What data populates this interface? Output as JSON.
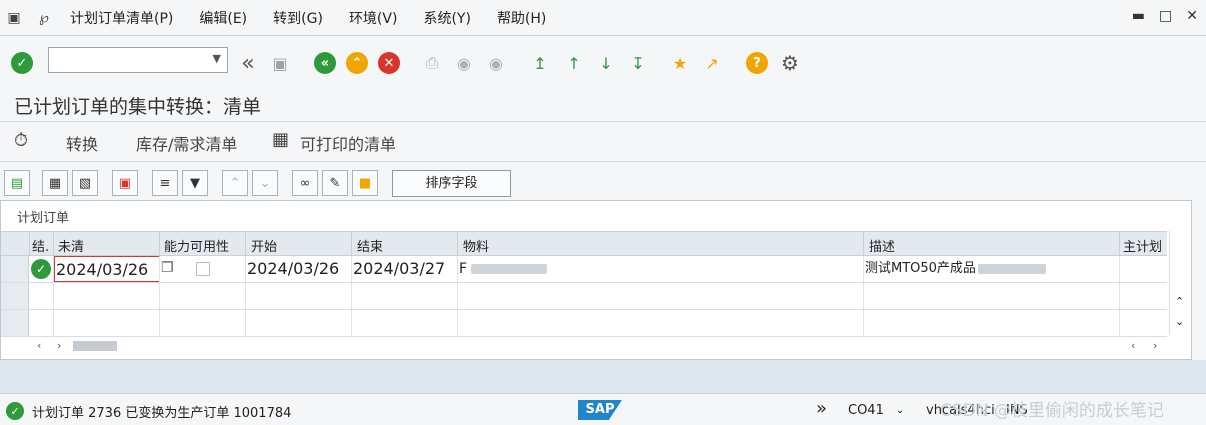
{
  "menu": {
    "items": [
      {
        "label": "计划订单清单(P)"
      },
      {
        "label": "编辑(E)"
      },
      {
        "label": "转到(G)"
      },
      {
        "label": "环境(V)"
      },
      {
        "label": "系统(Y)"
      },
      {
        "label": "帮助(H)"
      }
    ]
  },
  "page": {
    "title": "已计划订单的集中转换：清单"
  },
  "app_toolbar": {
    "convert": "转换",
    "stock_req": "库存/需求清单",
    "printable": "可打印的清单"
  },
  "alv": {
    "sort_button": "排序字段",
    "grid_title": "计划订单",
    "columns": [
      {
        "label": "结."
      },
      {
        "label": "未清"
      },
      {
        "label": "能力可用性"
      },
      {
        "label": "开始"
      },
      {
        "label": "结束"
      },
      {
        "label": "物料"
      },
      {
        "label": "描述"
      },
      {
        "label": "主计划"
      }
    ],
    "rows": [
      {
        "status": "done",
        "open": "2024/03/26",
        "start": "2024/03/26",
        "end": "2024/03/27",
        "material": "F",
        "description": "测试MTO50产成品"
      }
    ]
  },
  "statusbar": {
    "message": "计划订单 2736 已变换为生产订单 1001784",
    "logo": "SAP",
    "tcode": "CO41",
    "system": "vhcals4hci",
    "mode": "INS",
    "watermark": "CSDN @枝里偷闲的成长笔记"
  },
  "colors": {
    "green": "#2e9a3a",
    "orange": "#f0a500",
    "red": "#d9352b",
    "sap_blue": "#1f86c9"
  }
}
